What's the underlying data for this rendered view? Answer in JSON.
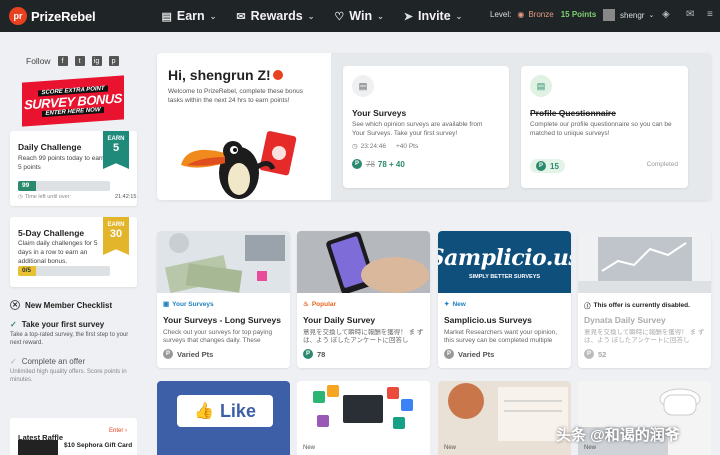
{
  "header": {
    "logo_mark": "pr",
    "brand": "PrizeRebel",
    "nav": [
      {
        "icon": "wallet-icon",
        "glyph": "▤",
        "label": "Earn"
      },
      {
        "icon": "gift-icon",
        "glyph": "✉",
        "label": "Rewards"
      },
      {
        "icon": "heart-icon",
        "glyph": "♡",
        "label": "Win"
      },
      {
        "icon": "paper-plane-icon",
        "glyph": "➤",
        "label": "Invite"
      }
    ],
    "level_label": "Level:",
    "level_value": "Bronze",
    "points": "15 Points",
    "username": "shengr"
  },
  "sidebar": {
    "follow_label": "Follow",
    "social": [
      "f",
      "t",
      "ig",
      "p"
    ],
    "banner": {
      "top": "SCORE EXTRA POINT",
      "main": "SURVEY BONUS",
      "bottom": "ENTER HERE NOW"
    },
    "daily": {
      "title": "Daily Challenge",
      "desc": "Reach 99 points today to earn 5 points",
      "earn_label": "EARN",
      "earn_value": "5",
      "progress_label": "99",
      "progress": 1.0,
      "time_left": "Time left until over:",
      "time": "21:42:15",
      "accent": "#1f8a7a"
    },
    "five_day": {
      "title": "5-Day Challenge",
      "desc": "Claim daily challenges for 5 days in a row to earn an additional bonus.",
      "earn_label": "EARN",
      "earn_value": "30",
      "progress_label": "0/5",
      "progress": 0.0,
      "accent": "#e2b52a"
    },
    "checklist": {
      "title": "New Member Checklist",
      "items": [
        {
          "title": "Take your first survey",
          "desc": "Take a top-rated survey, the first step to your next reward."
        },
        {
          "title": "Complete an offer",
          "desc": "Unlimited high quality offers. Score points in minutes."
        }
      ]
    },
    "raffle": {
      "title": "Latest Raffle",
      "enter": "Enter ›",
      "prize": "$10 Sephora Gift Card"
    }
  },
  "welcome": {
    "greeting": "Hi, shengrun Z!",
    "subtitle": "Welcome to PrizeRebel, complete these bonus tasks within the next 24 hrs to earn points!",
    "tasks": [
      {
        "title": "Your Surveys",
        "desc": "See which opinion surveys are available from Your Surveys. Take your first survey!",
        "timer": "23:24:46",
        "bonus": "+40 Pts",
        "old_pts": "78",
        "new_pts": "78 + 40"
      },
      {
        "title": "Profile Questionnaire",
        "desc": "Complete our profile questionnaire so you can be matched to unique surveys!",
        "pts": "15",
        "status": "Completed"
      }
    ]
  },
  "offers": [
    {
      "tag": "Your Surveys",
      "tag_color": "#1e7fc1",
      "title": "Your Surveys - Long Surveys",
      "desc": "Check out your surveys for top paying surveys that changes daily. These",
      "pts": "Varied Pts"
    },
    {
      "tag": "Popular",
      "tag_color": "#e8631f",
      "title": "Your Daily Survey",
      "desc": "意見を交換して瞬時に報酬を獲得！ ま ず は、よう ぼしたアンケートに回答し",
      "pts": "78"
    },
    {
      "tag": "New",
      "tag_color": "#1e7fc1",
      "title": "Samplicio.us Surveys",
      "desc": "Market Researchers want your opinion, this survey can be completed multiple",
      "pts": "Varied Pts"
    },
    {
      "tag": "This offer is currently disabled.",
      "tag_color": "#222",
      "title": "Dynata Daily Survey",
      "desc": "意見を交換して瞬時に報酬を獲得！ ま ず は、よう ぼしたアンケートに回答し",
      "pts": "52"
    }
  ],
  "samplicious_logo": {
    "name": "Samplicio.us",
    "tagline": "SIMPLY BETTER SURVEYS"
  },
  "bottom_offers": [
    {
      "label": "Like",
      "tag": ""
    },
    {
      "label": "",
      "tag": "New"
    },
    {
      "label": "",
      "tag": "New"
    },
    {
      "label": "",
      "tag": "New"
    }
  ],
  "watermark": "头条 @和谒的润爷"
}
